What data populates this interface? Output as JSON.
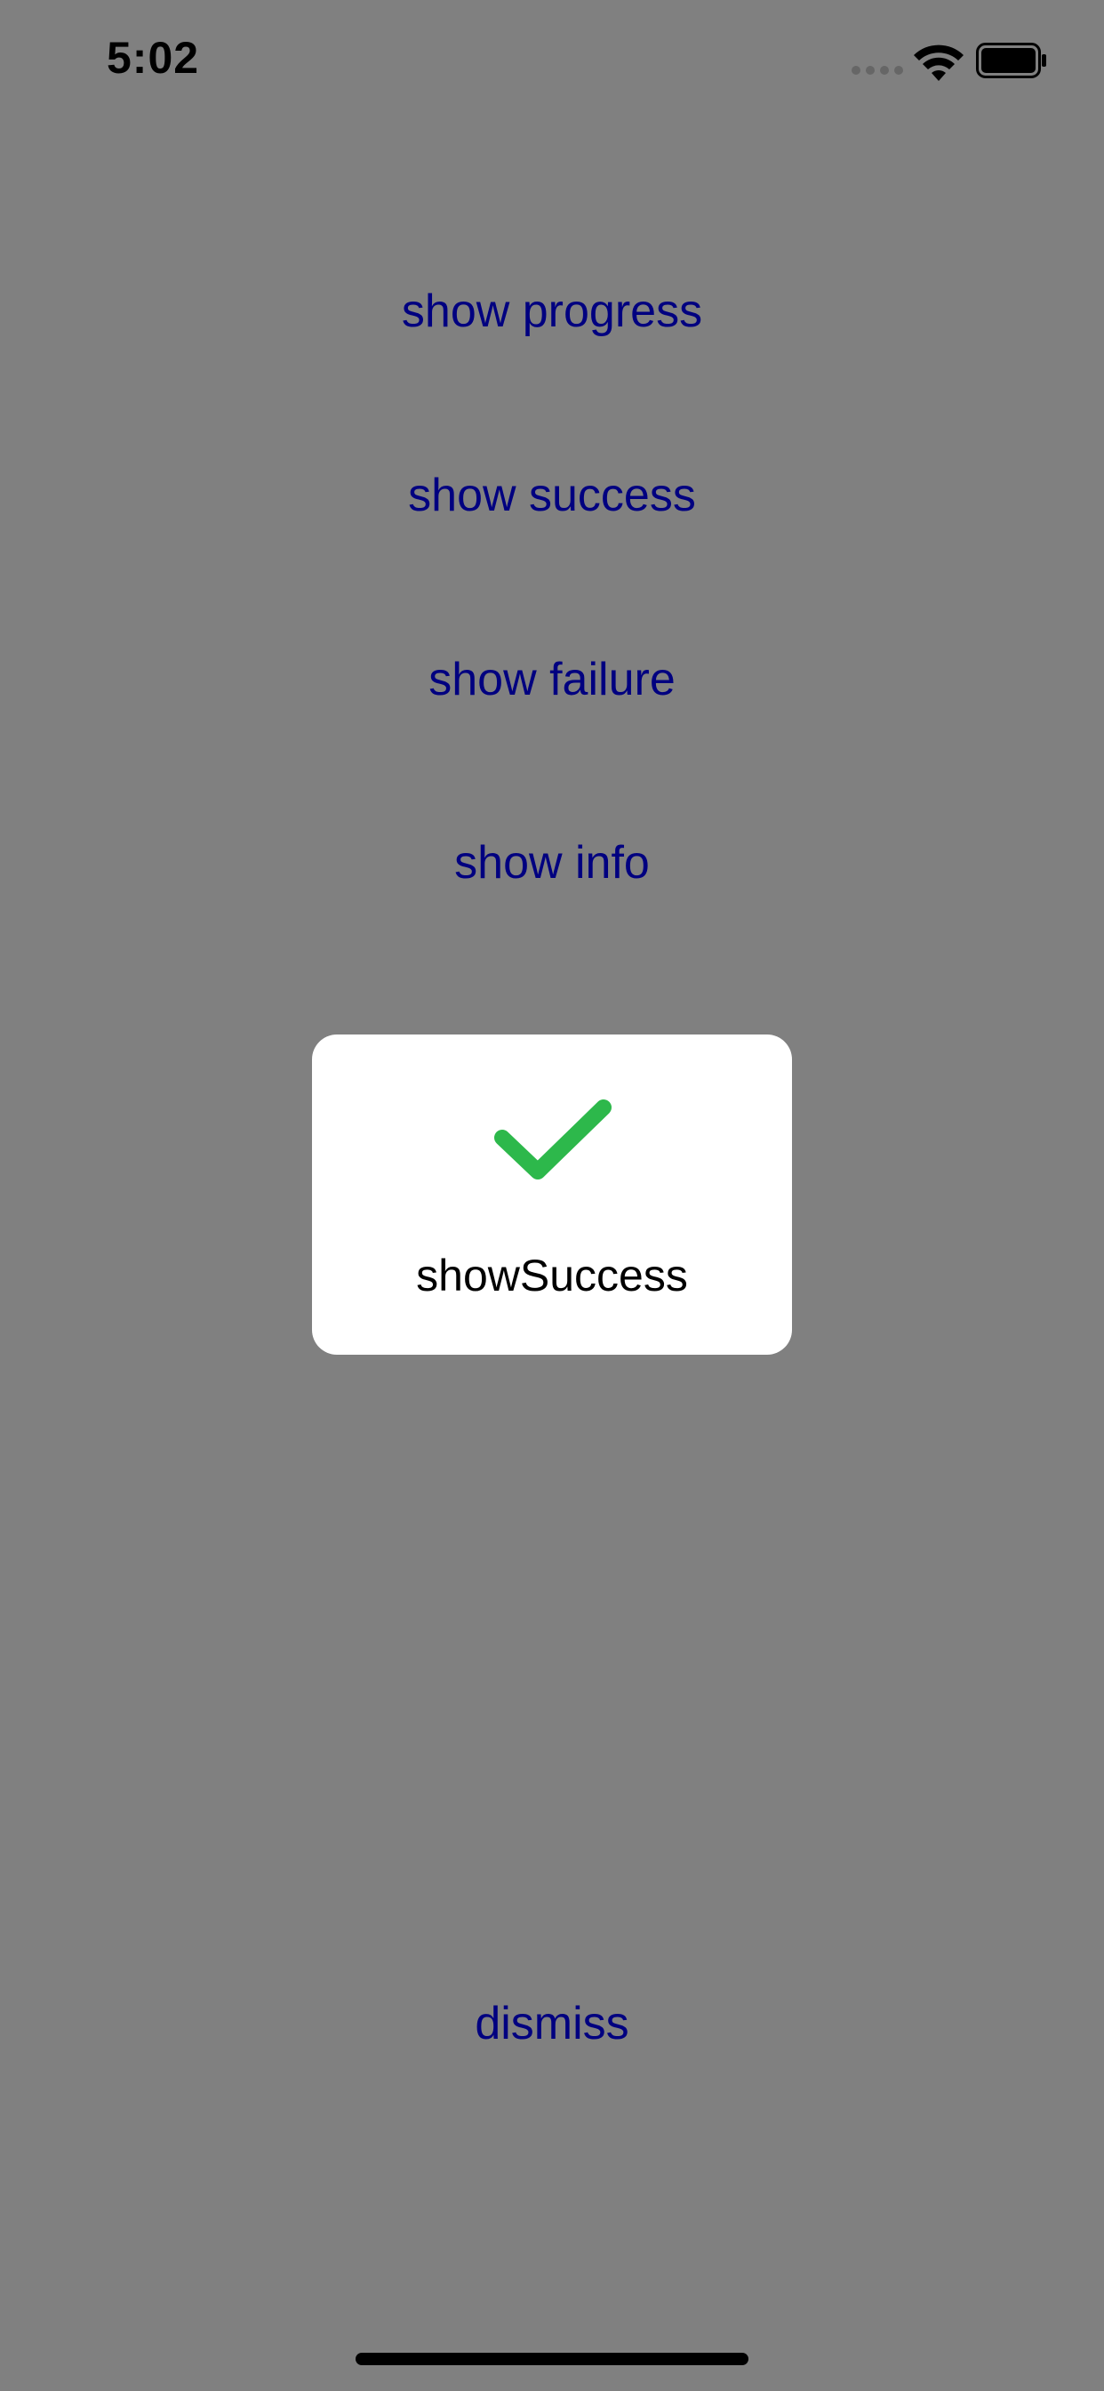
{
  "status_bar": {
    "time": "5:02",
    "icons": [
      "cellular-signal-icon",
      "wifi-icon",
      "battery-icon"
    ]
  },
  "buttons": {
    "show_progress": "show progress",
    "show_success": "show success",
    "show_failure": "show failure",
    "show_info": "show info",
    "dismiss": "dismiss"
  },
  "hud": {
    "icon": "checkmark-icon",
    "message": "showSuccess",
    "icon_color": "#2db84b"
  },
  "colors": {
    "background": "#808080",
    "button_text": "#000080",
    "hud_background": "#ffffff"
  }
}
